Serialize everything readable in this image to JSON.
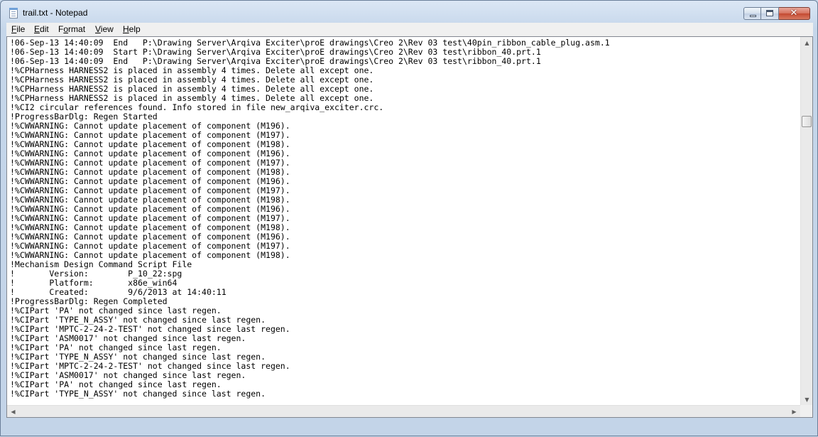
{
  "window": {
    "title": "trail.txt - Notepad"
  },
  "caption_buttons": {
    "close_glyph": "✕"
  },
  "menu": [
    {
      "accel": "F",
      "rest": "ile"
    },
    {
      "accel": "E",
      "rest": "dit"
    },
    {
      "pre": "F",
      "accel": "o",
      "rest": "rmat"
    },
    {
      "accel": "V",
      "rest": "iew"
    },
    {
      "accel": "H",
      "rest": "elp"
    }
  ],
  "document": {
    "lines": [
      "!06-Sep-13 14:40:09  End   P:\\Drawing Server\\Arqiva Exciter\\proE drawings\\Creo 2\\Rev 03 test\\40pin_ribbon_cable_plug.asm.1",
      "!06-Sep-13 14:40:09  Start P:\\Drawing Server\\Arqiva Exciter\\proE drawings\\Creo 2\\Rev 03 test\\ribbon_40.prt.1",
      "!06-Sep-13 14:40:09  End   P:\\Drawing Server\\Arqiva Exciter\\proE drawings\\Creo 2\\Rev 03 test\\ribbon_40.prt.1",
      "!%CPHarness HARNESS2 is placed in assembly 4 times. Delete all except one.",
      "!%CPHarness HARNESS2 is placed in assembly 4 times. Delete all except one.",
      "!%CPHarness HARNESS2 is placed in assembly 4 times. Delete all except one.",
      "!%CPHarness HARNESS2 is placed in assembly 4 times. Delete all except one.",
      "!%CI2 circular references found. Info stored in file new_arqiva_exciter.crc.",
      "!ProgressBarDlg: Regen Started",
      "!%CWWARNING: Cannot update placement of component (M196).",
      "!%CWWARNING: Cannot update placement of component (M197).",
      "!%CWWARNING: Cannot update placement of component (M198).",
      "!%CWWARNING: Cannot update placement of component (M196).",
      "!%CWWARNING: Cannot update placement of component (M197).",
      "!%CWWARNING: Cannot update placement of component (M198).",
      "!%CWWARNING: Cannot update placement of component (M196).",
      "!%CWWARNING: Cannot update placement of component (M197).",
      "!%CWWARNING: Cannot update placement of component (M198).",
      "!%CWWARNING: Cannot update placement of component (M196).",
      "!%CWWARNING: Cannot update placement of component (M197).",
      "!%CWWARNING: Cannot update placement of component (M198).",
      "!%CWWARNING: Cannot update placement of component (M196).",
      "!%CWWARNING: Cannot update placement of component (M197).",
      "!%CWWARNING: Cannot update placement of component (M198).",
      "!Mechanism Design Command Script File",
      "!       Version:        P_10_22:spg",
      "!       Platform:       x86e_win64",
      "!       Created:        9/6/2013 at 14:40:11",
      "!ProgressBarDlg: Regen Completed",
      "!%CIPart 'PA' not changed since last regen.",
      "!%CIPart 'TYPE_N_ASSY' not changed since last regen.",
      "!%CIPart 'MPTC-2-24-2-TEST' not changed since last regen.",
      "!%CIPart 'ASM0017' not changed since last regen.",
      "!%CIPart 'PA' not changed since last regen.",
      "!%CIPart 'TYPE_N_ASSY' not changed since last regen.",
      "!%CIPart 'MPTC-2-24-2-TEST' not changed since last regen.",
      "!%CIPart 'ASM0017' not changed since last regen.",
      "!%CIPart 'PA' not changed since last regen.",
      "!%CIPart 'TYPE_N_ASSY' not changed since last regen."
    ]
  },
  "scrollbars": {
    "vertical_position_fraction": 0.2,
    "up_arrow": "▲",
    "down_arrow": "▼",
    "left_arrow": "◀",
    "right_arrow": "▶"
  },
  "colors": {
    "titlebar": "#c5d6ea",
    "close_button": "#c44a31",
    "editor_bg": "#ffffff"
  }
}
